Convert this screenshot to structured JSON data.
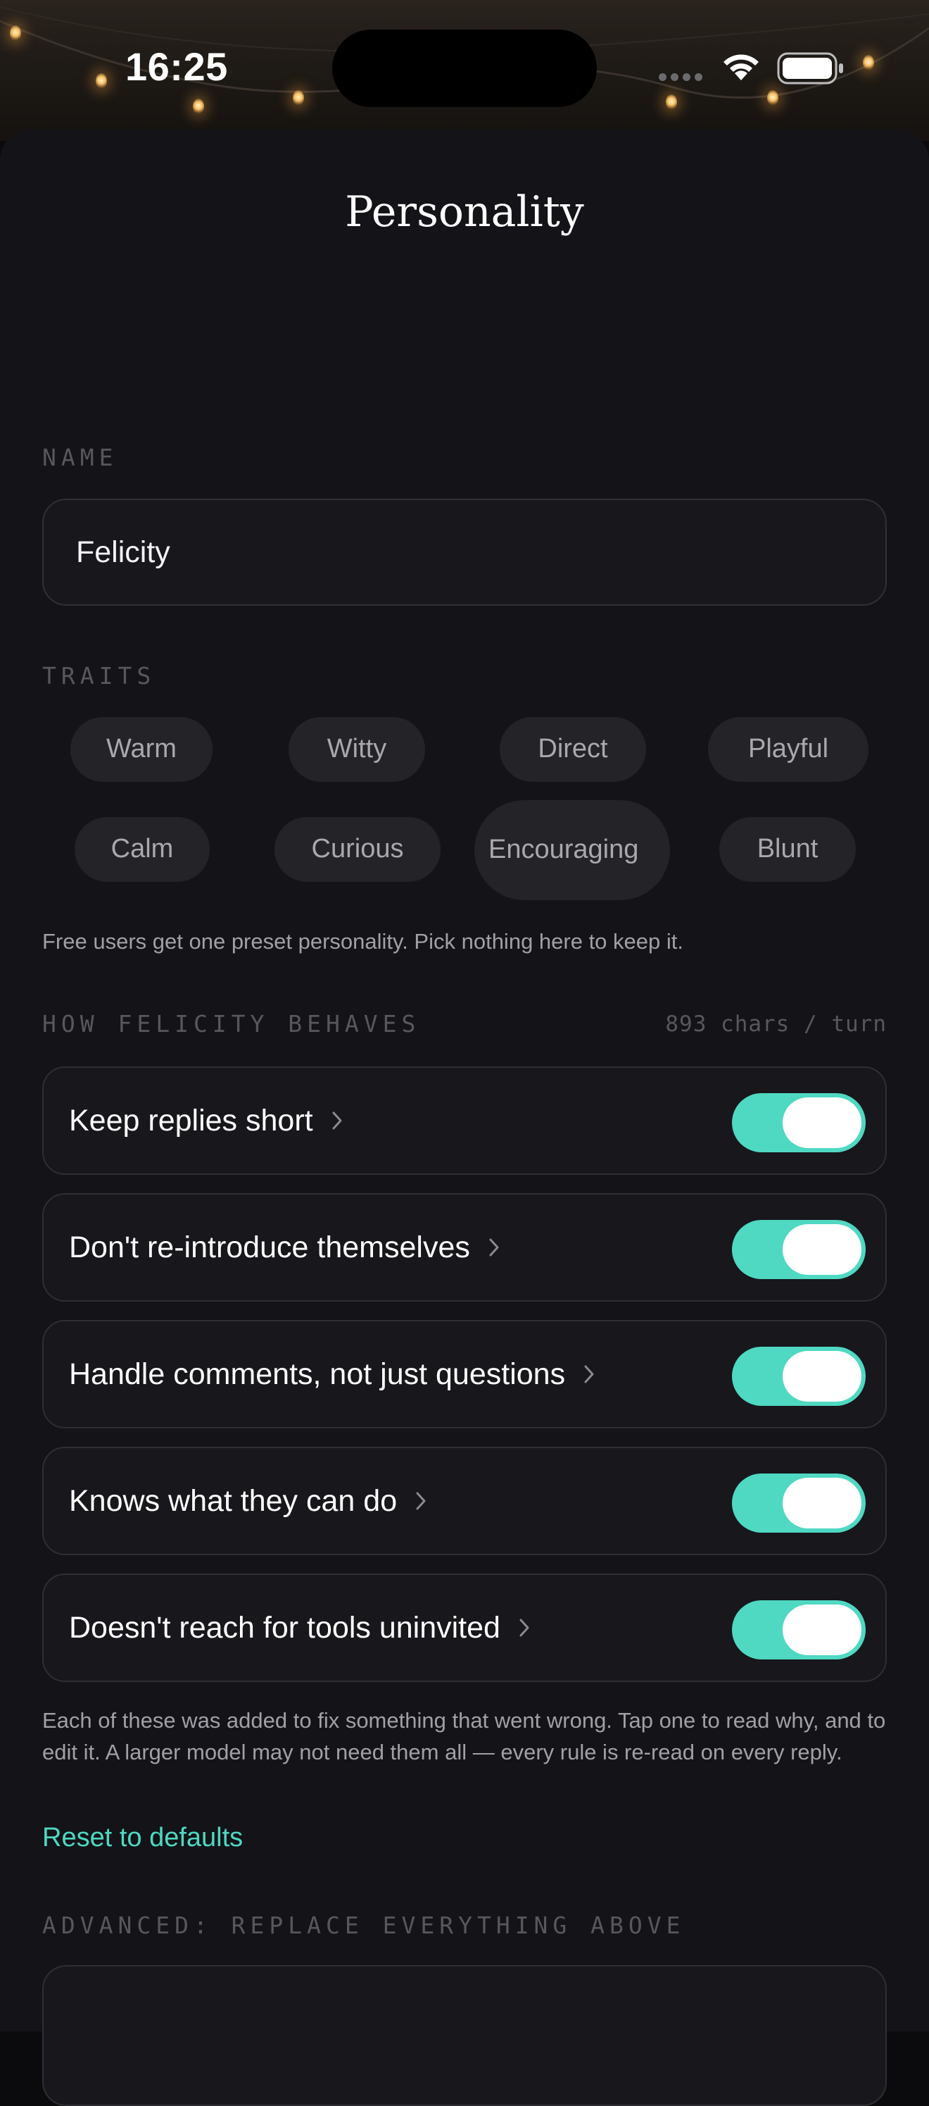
{
  "status_bar": {
    "time": "16:25"
  },
  "header": {
    "title": "Personality"
  },
  "name_section": {
    "label": "NAME",
    "value": "Felicity"
  },
  "traits_section": {
    "label": "TRAITS",
    "chips": [
      "Warm",
      "Witty",
      "Direct",
      "Playful",
      "Calm",
      "Curious",
      "Encouraging",
      "Blunt"
    ],
    "note": "Free users get one preset personality. Pick nothing here to keep it."
  },
  "behaves_section": {
    "label": "HOW FELICITY BEHAVES",
    "counter": "893 chars / turn",
    "rules": [
      {
        "label": "Keep replies short",
        "enabled": true
      },
      {
        "label": "Don't re-introduce themselves",
        "enabled": true
      },
      {
        "label": "Handle comments, not just questions",
        "enabled": true
      },
      {
        "label": "Knows what they can do",
        "enabled": true
      },
      {
        "label": "Doesn't reach for tools uninvited",
        "enabled": true
      }
    ],
    "note": "Each of these was added to fix something that went wrong. Tap one to read why, and to edit it. A larger model may not need them all — every rule is re-read on every reply.",
    "reset_label": "Reset to defaults"
  },
  "advanced_section": {
    "label": "ADVANCED: REPLACE EVERYTHING ABOVE"
  },
  "colors": {
    "accent": "#4fd8c2",
    "background": "#131318",
    "card": "#17171c",
    "chip": "#232328"
  }
}
